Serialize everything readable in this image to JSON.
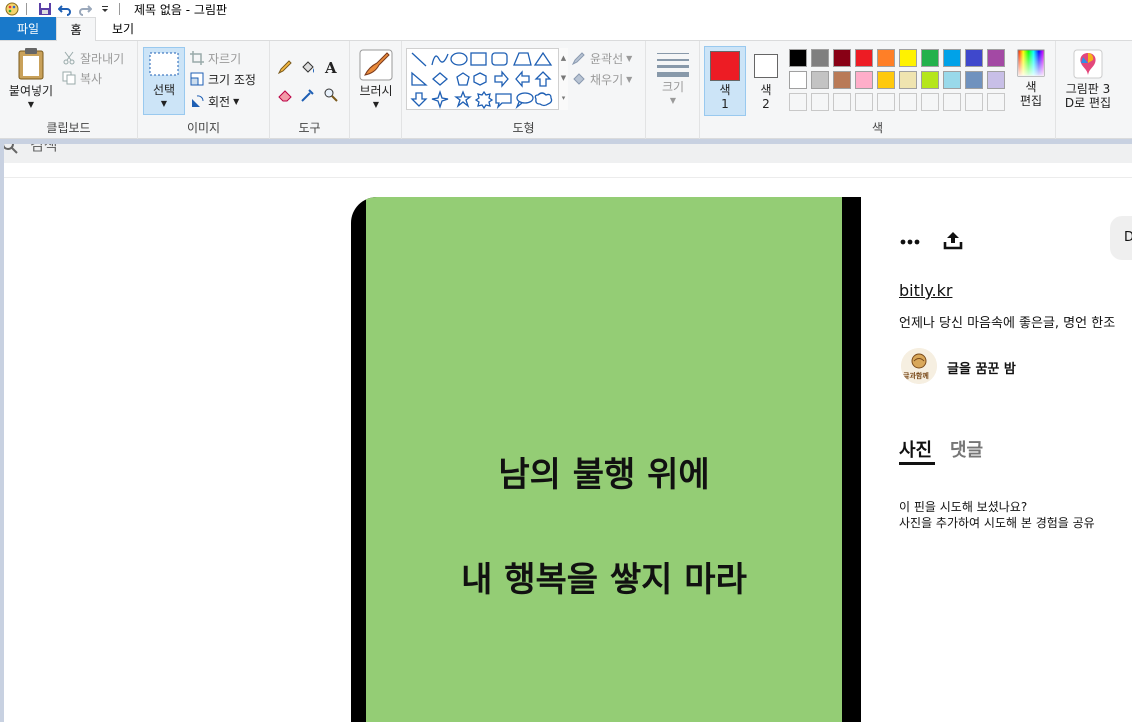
{
  "window": {
    "title": "제목 없음 - 그림판"
  },
  "menu": {
    "file": "파일",
    "home": "홈",
    "view": "보기"
  },
  "ribbon": {
    "clipboard": {
      "group": "클립보드",
      "paste": "붙여넣기",
      "cut": "잘라내기",
      "copy": "복사"
    },
    "image": {
      "group": "이미지",
      "select": "선택",
      "crop": "자르기",
      "resize": "크기 조정",
      "rotate": "회전"
    },
    "tools": {
      "group": "도구"
    },
    "brushes": {
      "label": "브러시"
    },
    "shapes": {
      "group": "도형",
      "outline": "윤곽선",
      "fill": "채우기"
    },
    "size": {
      "label": "크기"
    },
    "colors": {
      "group": "색",
      "color1_label": "색",
      "color1_num": "1",
      "color2_label": "색",
      "color2_num": "2",
      "color1_value": "#ed1c24",
      "color2_value": "#ffffff",
      "edit": "색",
      "edit2": "편집",
      "row1": [
        "#000000",
        "#7f7f7f",
        "#880015",
        "#ed1c24",
        "#ff7f27",
        "#fff200",
        "#22b14c",
        "#00a2e8",
        "#3f48cc",
        "#a349a4"
      ],
      "row2": [
        "#ffffff",
        "#c3c3c3",
        "#b97a57",
        "#ffaec9",
        "#ffc90e",
        "#efe4b0",
        "#b5e61d",
        "#99d9ea",
        "#7092be",
        "#c8bfe7"
      ]
    },
    "paint3d": {
      "line1": "그림판 3",
      "line2": "D로 편집"
    }
  },
  "canvas": {
    "search_hint": "검색",
    "pin_image": {
      "line1": "남의 불행 위에",
      "line2": "내 행복을 쌓지 마라",
      "bg": "#94cd75"
    },
    "sidebar": {
      "pill_text": "D",
      "link": "bitly.kr",
      "description": "언제나 당신 마음속에 좋은글, 명언 한조",
      "author": "글을 꿈꾼 밤",
      "avatar_text": "글과함께",
      "tabs": {
        "photos": "사진",
        "comments": "댓글"
      },
      "info1": "이 핀을 시도해 보셨나요?",
      "info2": "사진을 추가하여 시도해 본 경험을 공유"
    }
  }
}
